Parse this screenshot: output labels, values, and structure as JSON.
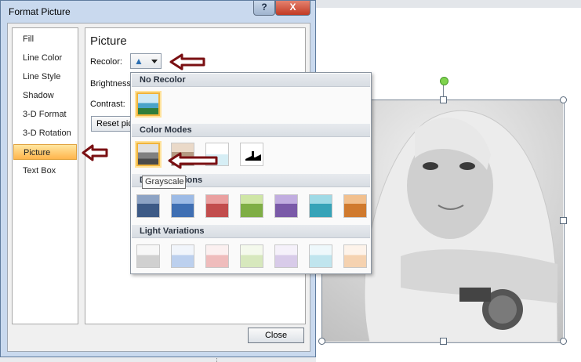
{
  "dialog": {
    "title": "Format Picture",
    "help_label": "?",
    "close_label": "X",
    "nav_items": [
      {
        "label": "Fill"
      },
      {
        "label": "Line Color"
      },
      {
        "label": "Line Style"
      },
      {
        "label": "Shadow"
      },
      {
        "label": "3-D Format"
      },
      {
        "label": "3-D Rotation"
      },
      {
        "label": "Picture",
        "selected": true
      },
      {
        "label": "Text Box"
      }
    ],
    "panel": {
      "title": "Picture",
      "recolor_label": "Recolor:",
      "brightness_label": "Brightness",
      "contrast_label": "Contrast:",
      "reset_label": "Reset pic"
    },
    "close_button": "Close"
  },
  "recolor_menu": {
    "sections": {
      "no_recolor": "No Recolor",
      "color_modes": "Color Modes",
      "dark_variations": "Dark Variations",
      "light_variations": "Light Variations"
    },
    "tooltip": "Grayscale",
    "swatch_colors": {
      "no_recolor": "#4aa3c9",
      "color_modes": [
        "#808080",
        "#b59a82",
        "#d6eef5",
        "#000000"
      ],
      "dark": [
        "#3d5a86",
        "#3f6fb3",
        "#c24d4d",
        "#7fae45",
        "#7a5aa8",
        "#36a3b8",
        "#d07a2e"
      ],
      "light": [
        "#d0d0d0",
        "#bcd0ee",
        "#efbcbc",
        "#d7e8bd",
        "#d8cbe9",
        "#c0e5ee",
        "#f5d2b0"
      ]
    }
  },
  "annotation_arrow_color": "#7a0f12"
}
